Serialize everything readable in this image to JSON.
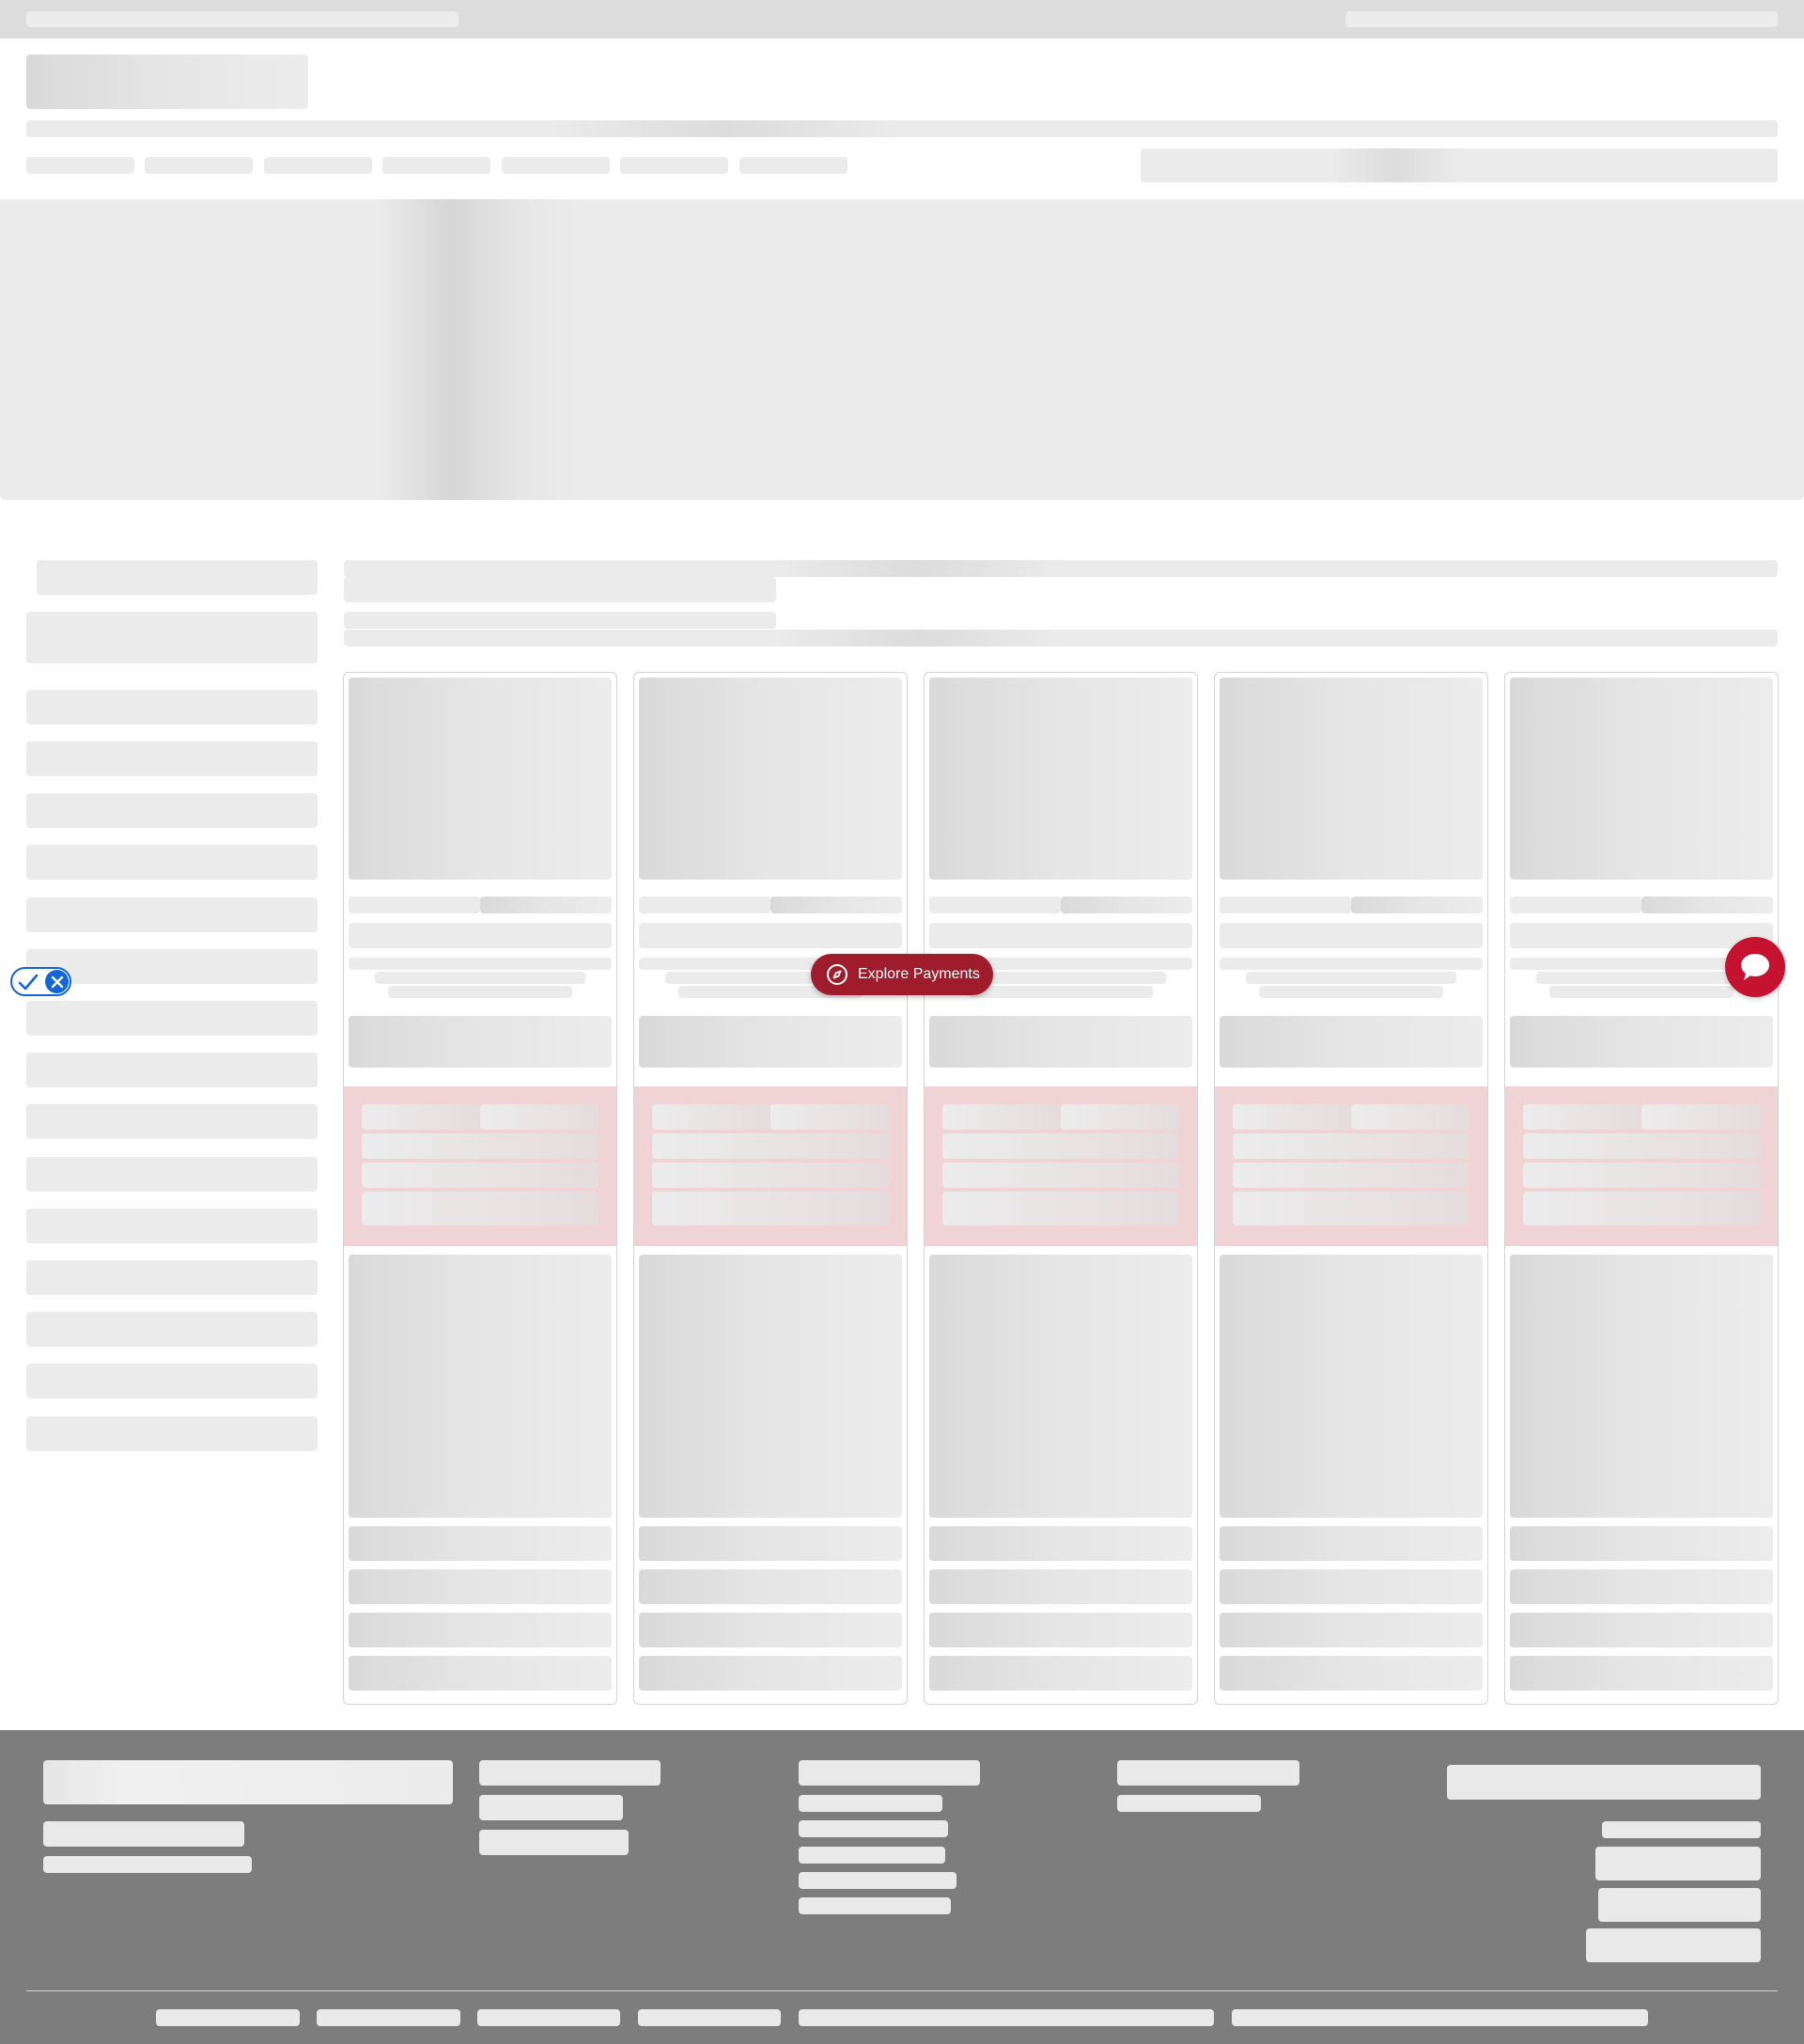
{
  "floating": {
    "explore_label": "Explore Payments",
    "explore_icon": "compass-icon",
    "chat_icon": "chat-bubble-icon",
    "a11y_icons": [
      "check-icon",
      "close-icon"
    ],
    "brand_red": "#9f1c2d",
    "chat_red": "#c41230",
    "toggle_blue": "#1565d8"
  },
  "colors": {
    "skeleton": "#ebebeb",
    "footer_bg": "#7d7d7d",
    "card_band": "#f0d3d5",
    "topbar_bg": "#dcdcdc"
  }
}
